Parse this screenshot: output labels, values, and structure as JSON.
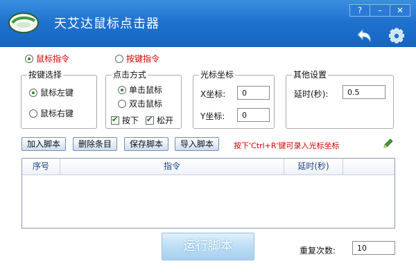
{
  "window": {
    "title": "天艾达鼠标点击器",
    "help_label": "?",
    "minimize_label": "–",
    "close_label": "✕"
  },
  "mode": {
    "mouse_label": "鼠标指令",
    "key_label": "按键指令",
    "selected": "mouse"
  },
  "button_group": {
    "title": "按键选择",
    "left_label": "鼠标左键",
    "right_label": "鼠标右键",
    "selected": "left"
  },
  "click_group": {
    "title": "点击方式",
    "single_label": "单击鼠标",
    "double_label": "双击鼠标",
    "selected": "single",
    "press_label": "按下",
    "release_label": "松开",
    "press_checked": true,
    "release_checked": true
  },
  "cursor_group": {
    "title": "光标坐标",
    "x_label": "X坐标:",
    "x_value": "0",
    "y_label": "Y坐标:",
    "y_value": "0"
  },
  "other_group": {
    "title": "其他设置",
    "delay_label": "延时(秒):",
    "delay_value": "0.5"
  },
  "toolbar": {
    "add_label": "加入脚本",
    "delete_label": "删除条目",
    "save_label": "保存脚本",
    "import_label": "导入脚本",
    "hint": "按下'Ctrl+R'键可录入光标坐标"
  },
  "table": {
    "columns": [
      "序号",
      "指令",
      "延时(秒)",
      ""
    ],
    "rows": []
  },
  "footer": {
    "run_label": "运行脚本",
    "repeat_label": "重复次数:",
    "repeat_value": "10"
  },
  "icons": {
    "app": "mouse-icon",
    "undo": "undo-arrow-icon",
    "settings": "gear-icon",
    "edit": "pencil-icon"
  },
  "colors": {
    "titlebar": "#1f73cf",
    "accent_red": "#d40000",
    "radio_dot": "#2a8a2a"
  }
}
